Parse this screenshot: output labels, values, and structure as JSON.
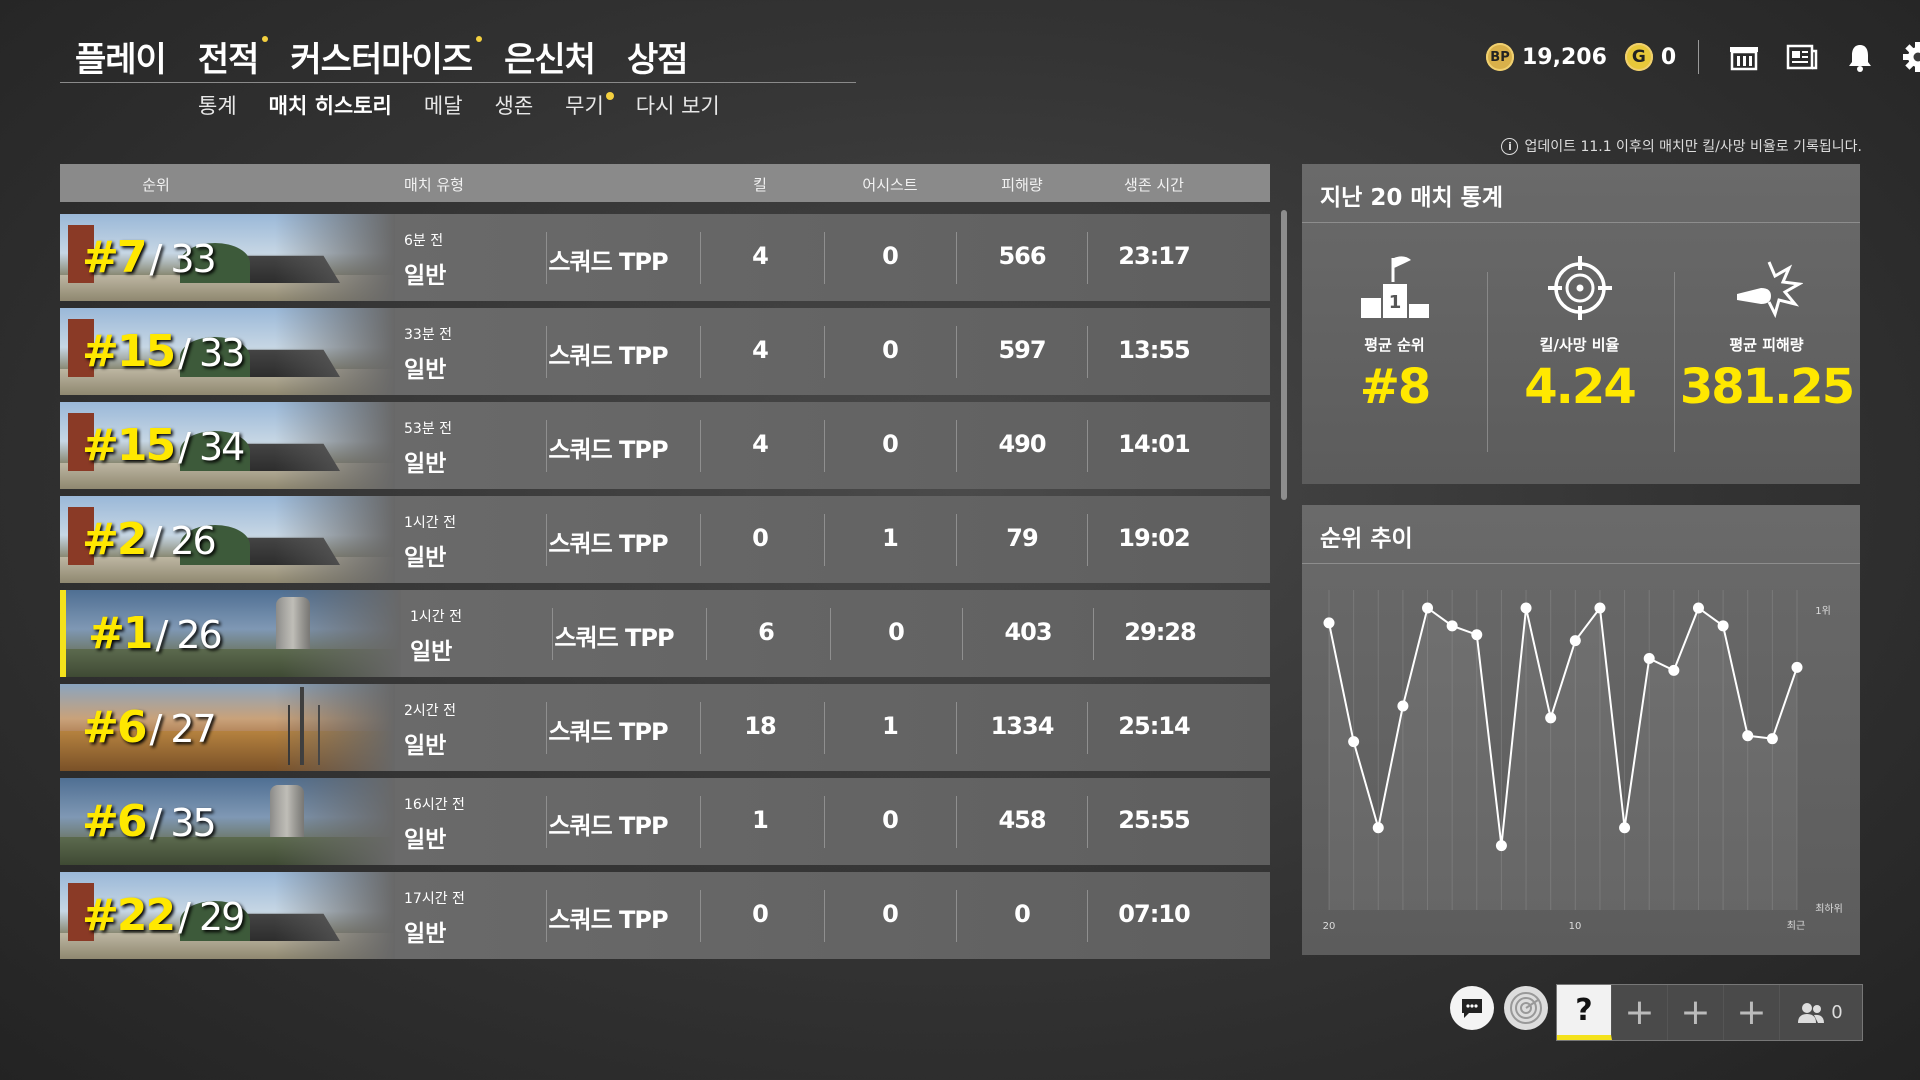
{
  "nav": {
    "main": [
      {
        "label": "플레이",
        "dot": false
      },
      {
        "label": "전적",
        "dot": true
      },
      {
        "label": "커스터마이즈",
        "dot": true
      },
      {
        "label": "은신처",
        "dot": false
      },
      {
        "label": "상점",
        "dot": false
      }
    ],
    "sub": [
      {
        "label": "통계",
        "dot": false,
        "active": false
      },
      {
        "label": "매치 히스토리",
        "dot": false,
        "active": true
      },
      {
        "label": "메달",
        "dot": false,
        "active": false
      },
      {
        "label": "생존",
        "dot": false,
        "active": false
      },
      {
        "label": "무기",
        "dot": true,
        "active": false
      },
      {
        "label": "다시 보기",
        "dot": false,
        "active": false
      }
    ]
  },
  "currency": {
    "bp_icon": "BP",
    "bp": "19,206",
    "g_icon": "G",
    "g": "0"
  },
  "notice": "업데이트 11.1 이후의 매치만 킬/사망 비율로 기록됩니다.",
  "table": {
    "headers": {
      "rank": "순위",
      "match_type": "매치 유형",
      "kills": "킬",
      "assists": "어시스트",
      "damage": "피해량",
      "survival": "생존 시간"
    },
    "rows": [
      {
        "rank": "#7",
        "total": "/ 33",
        "ago": "6분 전",
        "mode": "일반",
        "type": "스쿼드 TPP",
        "kills": "4",
        "assists": "0",
        "damage": "566",
        "time": "23:17",
        "map": "village",
        "win": false
      },
      {
        "rank": "#15",
        "total": "/ 33",
        "ago": "33분 전",
        "mode": "일반",
        "type": "스쿼드 TPP",
        "kills": "4",
        "assists": "0",
        "damage": "597",
        "time": "13:55",
        "map": "village",
        "win": false
      },
      {
        "rank": "#15",
        "total": "/ 34",
        "ago": "53분 전",
        "mode": "일반",
        "type": "스쿼드 TPP",
        "kills": "4",
        "assists": "0",
        "damage": "490",
        "time": "14:01",
        "map": "village",
        "win": false
      },
      {
        "rank": "#2",
        "total": "/ 26",
        "ago": "1시간 전",
        "mode": "일반",
        "type": "스쿼드 TPP",
        "kills": "0",
        "assists": "1",
        "damage": "79",
        "time": "19:02",
        "map": "village",
        "win": false
      },
      {
        "rank": "#1",
        "total": "/ 26",
        "ago": "1시간 전",
        "mode": "일반",
        "type": "스쿼드 TPP",
        "kills": "6",
        "assists": "0",
        "damage": "403",
        "time": "29:28",
        "map": "erangel",
        "win": true
      },
      {
        "rank": "#6",
        "total": "/ 27",
        "ago": "2시간 전",
        "mode": "일반",
        "type": "스쿼드 TPP",
        "kills": "18",
        "assists": "1",
        "damage": "1334",
        "time": "25:14",
        "map": "miramar",
        "win": false
      },
      {
        "rank": "#6",
        "total": "/ 35",
        "ago": "16시간 전",
        "mode": "일반",
        "type": "스쿼드 TPP",
        "kills": "1",
        "assists": "0",
        "damage": "458",
        "time": "25:55",
        "map": "erangel",
        "win": false
      },
      {
        "rank": "#22",
        "total": "/ 29",
        "ago": "17시간 전",
        "mode": "일반",
        "type": "스쿼드 TPP",
        "kills": "0",
        "assists": "0",
        "damage": "0",
        "time": "07:10",
        "map": "village",
        "win": false
      }
    ]
  },
  "stats": {
    "title": "지난 20 매치 통계",
    "avg_rank_label": "평균 순위",
    "avg_rank": "#8",
    "kd_label": "킬/사망 비율",
    "kd": "4.24",
    "avg_dmg_label": "평균 피해량",
    "avg_dmg": "381.25"
  },
  "trend": {
    "title": "순위 추이",
    "y_top_label": "1위",
    "y_bottom_label": "최하위",
    "x_left_label": "20",
    "x_mid_label": "10",
    "x_right_label": "최근"
  },
  "chart_data": {
    "type": "line",
    "title": "순위 추이",
    "xlabel": "",
    "ylabel": "",
    "x": [
      20,
      19,
      18,
      17,
      16,
      15,
      14,
      13,
      12,
      11,
      10,
      9,
      8,
      7,
      6,
      5,
      4,
      3,
      2,
      1
    ],
    "series": [
      {
        "values": [
          0.05,
          0.45,
          0.74,
          0.33,
          0,
          0.06,
          0.09,
          0.8,
          0,
          0.37,
          0.11,
          0,
          0.74,
          0.17,
          0.21,
          0,
          0.06,
          0.43,
          0.44,
          0.2
        ]
      }
    ],
    "y_scale": "placement (0 = 1위 top, 1 = 최하위 bottom)",
    "grid": true
  },
  "icons": {
    "coin_bp": "bp-coin-icon",
    "coin_g": "g-coin-icon",
    "store": "store-icon",
    "news": "news-icon",
    "bell": "bell-icon",
    "gear": "gear-icon",
    "info": "info-icon",
    "chat": "chat-icon",
    "radar": "radar-icon",
    "party": "party-icon",
    "podium": "podium-icon",
    "crosshair": "crosshair-icon",
    "bullet": "bullet-impact-icon"
  },
  "party": {
    "help": "?",
    "add": "+",
    "count": "0"
  },
  "colors": {
    "accent": "#ffe800",
    "dot": "#f4d03f"
  }
}
